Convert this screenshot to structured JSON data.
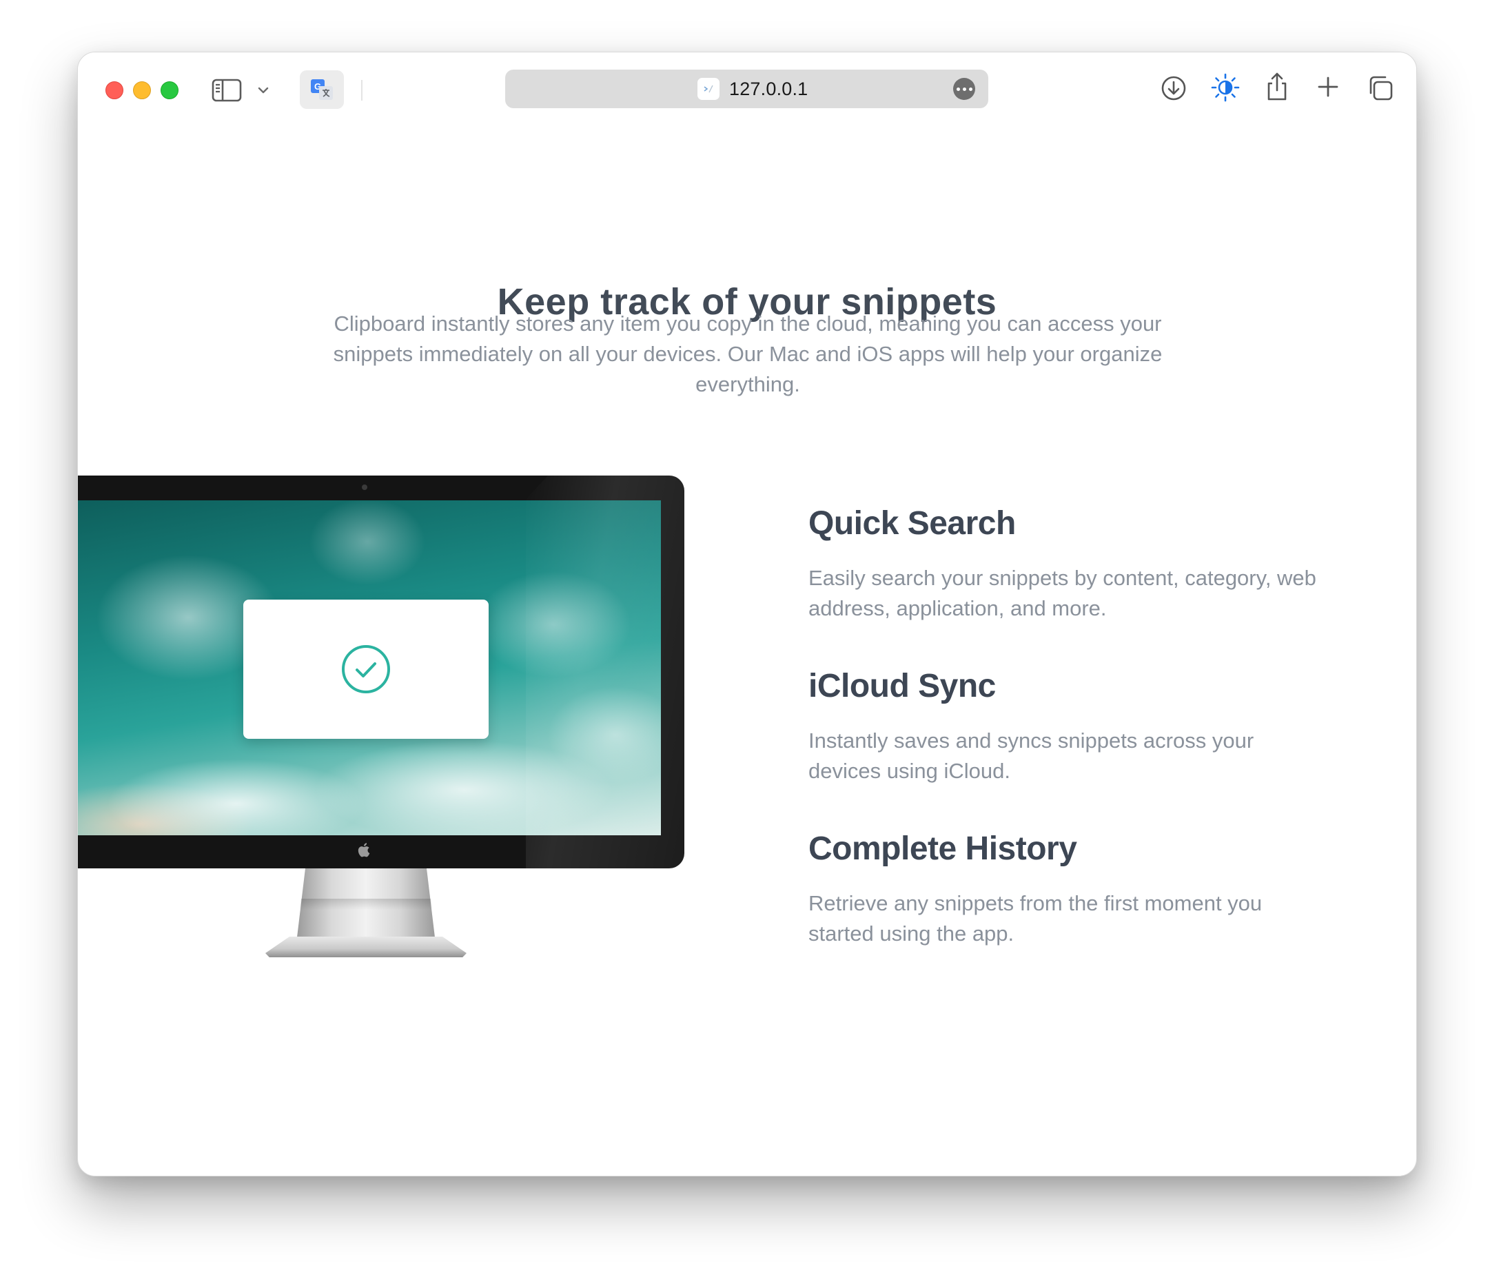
{
  "browser": {
    "url": "127.0.0.1"
  },
  "page": {
    "title": "Keep track of your snippets",
    "subtitle": "Clipboard instantly stores any item you copy in the cloud, meaning you can access your snippets immediately on all your devices. Our Mac and iOS apps will help your organize everything."
  },
  "features": [
    {
      "title": "Quick Search",
      "description": "Easily search your snippets by content, category, web address, application, and more."
    },
    {
      "title": "iCloud Sync",
      "description": "Instantly saves and syncs snippets across your devices using iCloud."
    },
    {
      "title": "Complete History",
      "description": "Retrieve any snippets from the first moment you started using the app."
    }
  ],
  "colors": {
    "heading": "#3d4654",
    "body_text": "#8a919b",
    "accent_teal": "#2bb3a0",
    "appearance_icon_blue": "#1a73e8"
  }
}
